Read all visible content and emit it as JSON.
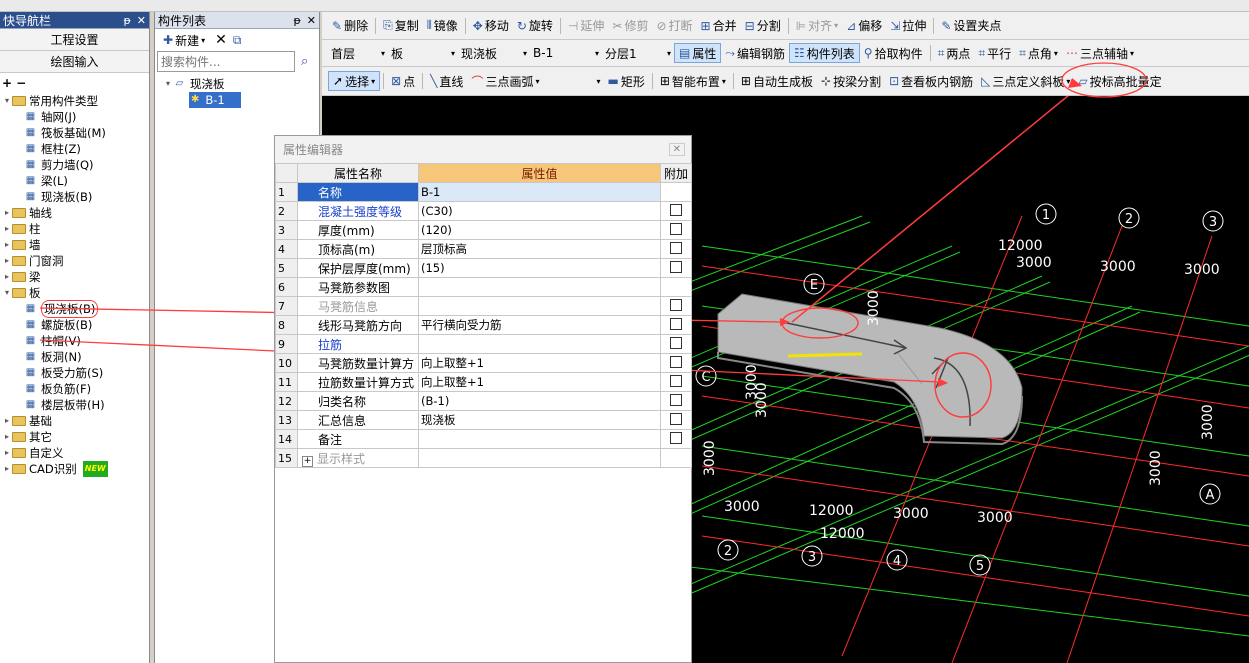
{
  "nav_panel": {
    "title": "快导航栏",
    "pin": "ᵽ",
    "close": "✕",
    "project_settings": "工程设置",
    "drawing_input": "绘图输入",
    "tree": [
      {
        "label": "常用构件类型",
        "level": 0,
        "expand": "▾",
        "icon": "folder",
        "open": true
      },
      {
        "label": "轴网(J)",
        "level": 1,
        "icon": "grid-icon"
      },
      {
        "label": "筏板基础(M)",
        "level": 1,
        "icon": "raft-icon"
      },
      {
        "label": "框柱(Z)",
        "level": 1,
        "icon": "column-icon"
      },
      {
        "label": "剪力墙(Q)",
        "level": 1,
        "icon": "wall-icon"
      },
      {
        "label": "梁(L)",
        "level": 1,
        "icon": "beam-icon"
      },
      {
        "label": "现浇板(B)",
        "level": 1,
        "icon": "slab-icon"
      },
      {
        "label": "轴线",
        "level": 0,
        "expand": "▸",
        "icon": "folder"
      },
      {
        "label": "柱",
        "level": 0,
        "expand": "▸",
        "icon": "folder"
      },
      {
        "label": "墙",
        "level": 0,
        "expand": "▸",
        "icon": "folder"
      },
      {
        "label": "门窗洞",
        "level": 0,
        "expand": "▸",
        "icon": "folder"
      },
      {
        "label": "梁",
        "level": 0,
        "expand": "▸",
        "icon": "folder"
      },
      {
        "label": "板",
        "level": 0,
        "expand": "▾",
        "icon": "folder",
        "open": true
      },
      {
        "label": "现浇板(B)",
        "level": 1,
        "icon": "slab-icon",
        "highlight": true
      },
      {
        "label": "螺旋板(B)",
        "level": 1,
        "icon": "spiral-slab-icon"
      },
      {
        "label": "柱帽(V)",
        "level": 1,
        "icon": "column-cap-icon"
      },
      {
        "label": "板洞(N)",
        "level": 1,
        "icon": "slab-hole-icon"
      },
      {
        "label": "板受力筋(S)",
        "level": 1,
        "icon": "slab-rebar-icon"
      },
      {
        "label": "板负筋(F)",
        "level": 1,
        "icon": "slab-neg-rebar-icon"
      },
      {
        "label": "楼层板带(H)",
        "level": 1,
        "icon": "floor-strip-icon"
      },
      {
        "label": "基础",
        "level": 0,
        "expand": "▸",
        "icon": "folder"
      },
      {
        "label": "其它",
        "level": 0,
        "expand": "▸",
        "icon": "folder"
      },
      {
        "label": "自定义",
        "level": 0,
        "expand": "▸",
        "icon": "folder"
      },
      {
        "label": "CAD识别",
        "level": 0,
        "expand": "▸",
        "icon": "folder",
        "badge": "NEW"
      }
    ]
  },
  "component_list": {
    "title": "构件列表",
    "pin": "ᵽ",
    "close": "✕",
    "new_label": "新建",
    "search_placeholder": "搜索构件...",
    "tree_root": "现浇板",
    "tree_child": "B-1"
  },
  "toolbar1": {
    "delete": "删除",
    "copy": "复制",
    "mirror": "镜像",
    "move": "移动",
    "rotate": "旋转",
    "extend": "延伸",
    "trim": "修剪",
    "break": "打断",
    "merge": "合并",
    "split": "分割",
    "align": "对齐",
    "offset": "偏移",
    "stretch": "拉伸",
    "set_grip": "设置夹点"
  },
  "toolbar2": {
    "floor": "首层",
    "type": "板",
    "subtype": "现浇板",
    "component": "B-1",
    "layer": "分层1",
    "property": "属性",
    "edit_rebar": "编辑钢筋",
    "component_list": "构件列表",
    "pick": "拾取构件",
    "two_point": "两点",
    "parallel": "平行",
    "point_angle": "点角",
    "three_point_axis": "三点辅轴"
  },
  "toolbar3": {
    "select": "选择",
    "point": "点",
    "line": "直线",
    "arc": "三点画弧",
    "rect": "矩形",
    "smart_layout": "智能布置",
    "auto_slab": "自动生成板",
    "split_by_beam": "按梁分割",
    "view_rebar": "查看板内钢筋",
    "three_point_slope": "三点定义斜板",
    "batch_by_height": "按标高批量定"
  },
  "property_editor": {
    "title": "属性编辑器",
    "close": "✕",
    "headers": {
      "name": "属性名称",
      "value": "属性值",
      "extra": "附加"
    },
    "rows": [
      {
        "num": "1",
        "name": "名称",
        "value": "B-1",
        "chk": false,
        "name_blue": false,
        "selected": true
      },
      {
        "num": "2",
        "name": "混凝土强度等级",
        "value": "(C30)",
        "chk": true,
        "name_blue": true
      },
      {
        "num": "3",
        "name": "厚度(mm)",
        "value": "(120)",
        "chk": true
      },
      {
        "num": "4",
        "name": "顶标高(m)",
        "value": "层顶标高",
        "chk": true
      },
      {
        "num": "5",
        "name": "保护层厚度(mm)",
        "value": "(15)",
        "chk": true
      },
      {
        "num": "6",
        "name": "马凳筋参数图",
        "value": "",
        "chk": false
      },
      {
        "num": "7",
        "name": "马凳筋信息",
        "value": "",
        "chk": true,
        "faded": true
      },
      {
        "num": "8",
        "name": "线形马凳筋方向",
        "value": "平行横向受力筋",
        "chk": true
      },
      {
        "num": "9",
        "name": "拉筋",
        "value": "",
        "chk": true,
        "name_blue": true
      },
      {
        "num": "10",
        "name": "马凳筋数量计算方",
        "value": "向上取整+1",
        "chk": true
      },
      {
        "num": "11",
        "name": "拉筋数量计算方式",
        "value": "向上取整+1",
        "chk": true
      },
      {
        "num": "12",
        "name": "归类名称",
        "value": "(B-1)",
        "chk": true
      },
      {
        "num": "13",
        "name": "汇总信息",
        "value": "现浇板",
        "chk": true
      },
      {
        "num": "14",
        "name": "备注",
        "value": "",
        "chk": true
      },
      {
        "num": "15",
        "name": "显示样式",
        "value": "",
        "chk": false,
        "expander": "+",
        "faded": true
      }
    ]
  },
  "canvas": {
    "axis_top": [
      "1",
      "2",
      "3"
    ],
    "axis_bottom": [
      "2",
      "3",
      "4",
      "5"
    ],
    "axis_left": [
      "E",
      "C"
    ],
    "axis_right": [
      "A"
    ],
    "dims": [
      "12000",
      "3000",
      "3000",
      "3000",
      "3000",
      "12000",
      "3000",
      "3000",
      "3000",
      "3000",
      "3000",
      "3000",
      "3000",
      "12000"
    ]
  },
  "colors": {
    "grid_green": "#1fd41f",
    "axis_red": "#ff2a2a",
    "annotation_red": "#ff3b3b",
    "slab_gray": "#b9b9b9",
    "header_orange": "#f6c77a",
    "highlight_blue": "#2864c7"
  }
}
